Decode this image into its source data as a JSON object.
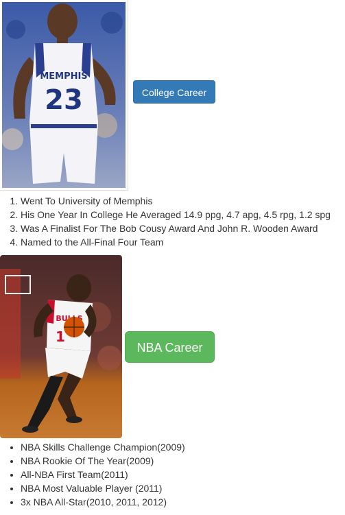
{
  "college": {
    "photo_label": "Memphis player photo",
    "button_label": "College Career",
    "facts": [
      "Went To University of Memphis",
      "His One Year In College He Averaged 14.9 ppg, 4.7 apg, 4.5 rpg, 1.2 spg",
      "Was A Finalist For The Bob Cousy Award And John R. Wooden Award",
      "Named to the All-Final Four Team"
    ]
  },
  "nba": {
    "photo_label": "Bulls player photo",
    "button_label": "NBA Career",
    "achievements": [
      "NBA Skills Challenge Champion(2009)",
      "NBA Rookie Of The Year(2009)",
      "All-NBA First Team(2011)",
      "NBA Most Valuable Player (2011)",
      "3x NBA All-Star(2010, 2011, 2012)"
    ]
  },
  "jersey_text": {
    "college_team": "MEMPHIS",
    "college_number": "23",
    "nba_team": "BULLS",
    "nba_number": "1"
  },
  "colors": {
    "primary_button": "#337ab7",
    "success_button": "#5cb85c"
  }
}
